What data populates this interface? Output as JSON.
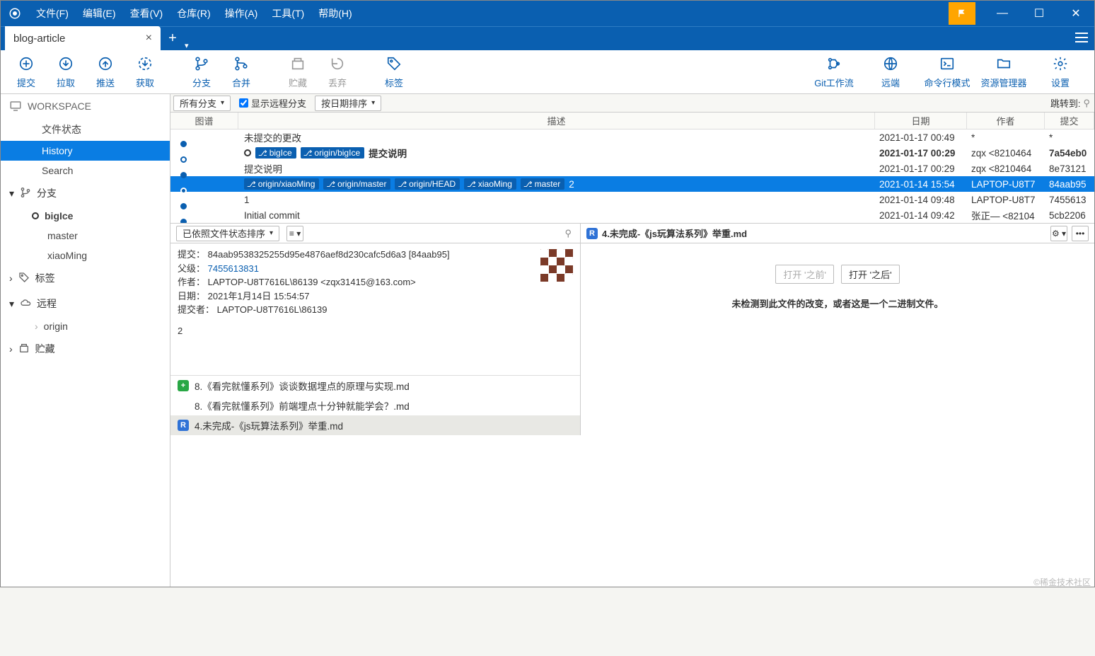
{
  "menu": [
    "文件(F)",
    "编辑(E)",
    "查看(V)",
    "仓库(R)",
    "操作(A)",
    "工具(T)",
    "帮助(H)"
  ],
  "tab": {
    "name": "blog-article"
  },
  "toolbar": {
    "left": [
      {
        "id": "commit",
        "label": "提交"
      },
      {
        "id": "pull",
        "label": "拉取"
      },
      {
        "id": "push",
        "label": "推送"
      },
      {
        "id": "fetch",
        "label": "获取"
      },
      {
        "id": "branch",
        "label": "分支"
      },
      {
        "id": "merge",
        "label": "合并"
      },
      {
        "id": "stash",
        "label": "贮藏",
        "disabled": true
      },
      {
        "id": "discard",
        "label": "丢弃",
        "disabled": true
      },
      {
        "id": "tag",
        "label": "标签"
      }
    ],
    "right": [
      {
        "id": "gitflow",
        "label": "Git工作流"
      },
      {
        "id": "remote",
        "label": "远端"
      },
      {
        "id": "cli",
        "label": "命令行模式"
      },
      {
        "id": "resmgr",
        "label": "资源管理器"
      },
      {
        "id": "settings",
        "label": "设置"
      }
    ]
  },
  "sidebar": {
    "workspace": {
      "label": "WORKSPACE",
      "items": [
        "文件状态",
        "History",
        "Search"
      ],
      "selected": 1
    },
    "branches": {
      "label": "分支",
      "items": [
        "bigIce",
        "master",
        "xiaoMing"
      ],
      "current": 0
    },
    "tags": {
      "label": "标签"
    },
    "remotes": {
      "label": "远程",
      "items": [
        "origin"
      ]
    },
    "stashes": {
      "label": "贮藏"
    }
  },
  "filter": {
    "allBranches": "所有分支",
    "showRemote": "显示远程分支",
    "sortByDate": "按日期排序",
    "jump": "跳转到:"
  },
  "columns": {
    "graph": "图谱",
    "desc": "描述",
    "date": "日期",
    "author": "作者",
    "commit": "提交"
  },
  "commits": [
    {
      "kind": "uncommitted",
      "desc": "未提交的更改",
      "date": "2021-01-17 00:49",
      "author": "*",
      "sha": "*"
    },
    {
      "kind": "head",
      "refs": [
        "bigIce",
        "origin/bigIce"
      ],
      "msg": "提交说明",
      "date": "2021-01-17 00:29",
      "author": "zqx <8210464",
      "sha": "7a54eb0"
    },
    {
      "msg": "提交说明",
      "date": "2021-01-17 00:29",
      "author": "zqx <8210464",
      "sha": "8e73121"
    },
    {
      "selected": true,
      "refs": [
        "origin/xiaoMing",
        "origin/master",
        "origin/HEAD",
        "xiaoMing",
        "master"
      ],
      "msg": "2",
      "date": "2021-01-14 15:54",
      "author": "LAPTOP-U8T7",
      "sha": "84aab95"
    },
    {
      "msg": "1",
      "date": "2021-01-14 09:48",
      "author": "LAPTOP-U8T7",
      "sha": "7455613"
    },
    {
      "msg": "Initial commit",
      "date": "2021-01-14 09:42",
      "author": "张正— <82104",
      "sha": "5cb2206",
      "last": true
    }
  ],
  "details": {
    "sort": "已依照文件状态排序",
    "commitLabel": "提交：",
    "commit": "84aab9538325255d95e4876aef8d230cafc5d6a3 [84aab95]",
    "parentLabel": "父级：",
    "parent": "7455613831",
    "authorLabel": "作者：",
    "author": "LAPTOP-U8T7616L\\86139 <zqx31415@163.com>",
    "dateLabel": "日期：",
    "date": "2021年1月14日 15:54:57",
    "committerLabel": "提交者：",
    "committer": "LAPTOP-U8T7616L\\86139",
    "message": "2",
    "files": [
      {
        "status": "add",
        "name": "8.《看完就懂系列》谈谈数据埋点的原理与实现.md"
      },
      {
        "status": "del",
        "name": "8.《看完就懂系列》前端埋点十分钟就能学会？.md"
      },
      {
        "status": "ren",
        "name": "4.未完成-《js玩算法系列》举重.md",
        "selected": true
      }
    ]
  },
  "diff": {
    "file": "4.未完成-《js玩算法系列》举重.md",
    "openBefore": "打开 '之前'",
    "openAfter": "打开 '之后'",
    "noChange": "未检测到此文件的改变，或者这是一个二进制文件。"
  },
  "watermark": "©稀金技术社区"
}
